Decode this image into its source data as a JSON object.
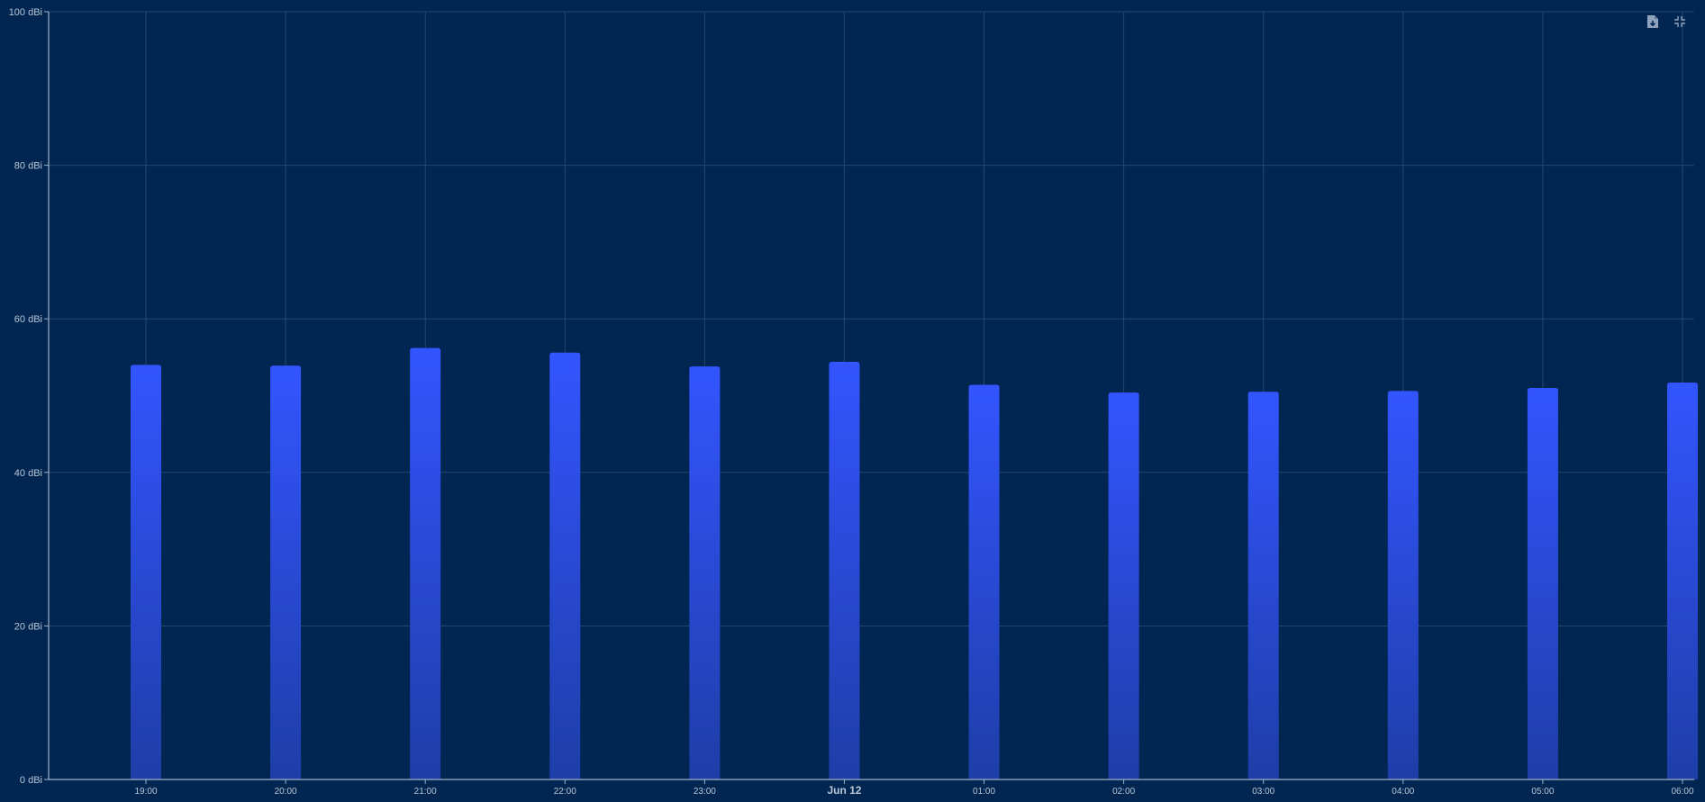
{
  "colors": {
    "background": "#012652",
    "bar_top": "#3355ff",
    "bar_bottom": "#1e3ea8",
    "grid": "#24486f",
    "axis": "#9fb2c8",
    "text": "#b9c6d6"
  },
  "toolbar": {
    "export_icon": "file-download-icon",
    "collapse_icon": "collapse-icon"
  },
  "chart_data": {
    "type": "bar",
    "title": "",
    "xlabel": "",
    "ylabel": "",
    "ylim": [
      0,
      100
    ],
    "y_ticks": [
      {
        "value": 0,
        "label": "0 dBi"
      },
      {
        "value": 20,
        "label": "20 dBi"
      },
      {
        "value": 40,
        "label": "40 dBi"
      },
      {
        "value": 60,
        "label": "60 dBi"
      },
      {
        "value": 80,
        "label": "80 dBi"
      },
      {
        "value": 100,
        "label": "100 dBi"
      }
    ],
    "categories": [
      "19:00",
      "20:00",
      "21:00",
      "22:00",
      "23:00",
      "Jun 12",
      "01:00",
      "02:00",
      "03:00",
      "04:00",
      "05:00",
      "06:00"
    ],
    "bold_categories": [
      "Jun 12"
    ],
    "values": [
      54.0,
      53.9,
      56.2,
      55.6,
      53.8,
      54.4,
      51.4,
      50.4,
      50.5,
      50.6,
      51.0,
      51.7
    ],
    "grid": true,
    "legend": "none"
  }
}
